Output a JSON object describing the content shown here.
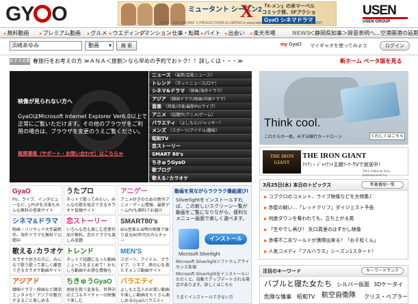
{
  "header": {
    "logo_prefix": "GY",
    "logo_suffix": "O",
    "banner": {
      "title": "ミュータント シーズン2",
      "x": "X",
      "promo": "『X-メン』の米マーベルコミック発、SFアクション!",
      "badge": "GyaO シネマドラマ",
      "copyright": "©2001 - 2002 MUTANT X PRODUCTIONS & LIMITED in association with FIREWORKS ENTERTAINMENT."
    },
    "usen_name": "USEN",
    "usen_group": "USEN GROUP"
  },
  "nav": {
    "items": [
      "無料動画",
      "プレミアム動画",
      "グルメ",
      "ウエディング",
      "マンション",
      "仕事・転職",
      "バイト",
      "出会い",
      "楽天市場"
    ],
    "news_label": "NEWS",
    "news_text": "＜静岡県知事＞辞意表明へ…空港開港の延期問"
  },
  "search": {
    "value": "浜崎あゆみ",
    "select": "動画",
    "button": "検 索",
    "mygyao_my": "my",
    "mygyao": "GyaO",
    "use_msg": "マイギャオを使ってみよう",
    "login": "ログイン"
  },
  "announce": {
    "tag": "おすすめ情報",
    "text": "春旅行をお考えの方 ≫ＡＮＡ＜旅割＞なら早めの予約でおトク！！詳しくは・・・≫",
    "newhome": "新ホーム ベータ版を見る"
  },
  "player": {
    "msg1": "映像が見られない方へ",
    "msg2": "GyaOはMicrosoft Internet Explorer Ver6.0以上で正常にご覧いただけます。その他のブラウザをご利用の場合は、ブラウザを変更のうえご覧ください。",
    "link": "推奨環境（サポート・お問い合わせ）はこちら≫"
  },
  "menu": [
    {
      "label": "ニュース",
      "sub": "（最新/芸能ニュース）"
    },
    {
      "label": "トレンド",
      "sub": "（ネットニュース/ロケ）"
    },
    {
      "label": "シネマ&ドラマ",
      "sub": "（映画/海外ドラマ）"
    },
    {
      "label": "アジア",
      "sub": "（韓国ドラマ/映画/中国ドラマ）"
    },
    {
      "label": "音楽",
      "sub": "（邦楽/洋楽/最新PV/ライブ）"
    },
    {
      "label": "アニメ",
      "sub": "（話題作/アニメ/ゲーム）"
    },
    {
      "label": "バラエティ",
      "sub": "（よしもと/ジャッキー）"
    },
    {
      "label": "メンズ",
      "sub": "（スポーツ/アイドル/趣味）"
    },
    {
      "label": "昭和TV",
      "sub": ""
    },
    {
      "label": "恋ストーリー",
      "sub": ""
    },
    {
      "label": "SMART 80's",
      "sub": ""
    },
    {
      "label": "ちきゅうGyaO",
      "sub": ""
    },
    {
      "label": "歌ブログ",
      "sub": ""
    },
    {
      "label": "歌える♪カラオケ",
      "sub": ""
    }
  ],
  "tiles": [
    {
      "title": "GyaO",
      "desc": "PV、ライブ、インタビューなど、J-POPを洋楽もみんな無料の音楽サイト",
      "color": "#c8102e"
    },
    {
      "title": "うたプロ",
      "desc": "ネットで歌ってみたい。みんなの歌を採点できるカラオケ投稿サイト",
      "color": "#222222"
    },
    {
      "title": "アニゲー",
      "desc": "アニメ好きのための新作アニメ・ゲーム情報、最新ゲームPVも無料でお届け",
      "color": "#e64a9a"
    },
    {
      "title": "シネマ&ドラマ",
      "desc": "映画・ハリウッド大作最新作。海外ドラマも無料で公開中",
      "color": "#1f5bc0"
    },
    {
      "title": "恋ストーリー",
      "desc": "いろんな恋も楽しむ恋愛作品が無料。恋のドラマも楽しみ放題",
      "color": "#d6337a"
    },
    {
      "title": "SMART80's",
      "desc": "80s音楽＆当時の映像で振り返る80年代のカルチャー",
      "color": "#333333"
    },
    {
      "title": "歌える♪カラオケ",
      "desc": "カラオケ好きの方に、みんなで歌う歌って楽しく練習できるカラオケ動画サイト",
      "color": "#222222"
    },
    {
      "title": "トレンド",
      "desc": "ネットで話題になった動画ニュースをまとめて！おもしろ動画やお得な情報も",
      "color": "#2b7a2b"
    },
    {
      "title": "MEN'S",
      "desc": "スポーツ、アイドル、グラビア、シネマ…男の心を満たすメンズ動画サイト",
      "color": "#2a7fb8"
    },
    {
      "title": "アジアド",
      "desc": "韓国ドラマ・映画など韓流エンタメも！アジアの魅力がまるごと楽しめる",
      "color": "#e05a1a"
    },
    {
      "title": "ちきゅうGyaO",
      "desc": "地球を救う変身を、世界中のエコ＆ネイチャーの映像で楽しむ",
      "color": "#2b8a2b"
    },
    {
      "title": "バラエティ",
      "desc": "よしもと芸人のお笑い動画や楽しい動画をたくさん楽しめるGyaOバラエティ",
      "color": "#e08a00"
    }
  ],
  "silverlight": {
    "heading": "動画を見ながらラクラク番組選び!",
    "desc": "Silverlightをインストールすれば、この新しいスクリーン一覧が動画をご覧になりながら、便利なメニュー画面で楽しく選べます。",
    "install": "インストール",
    "logo_text": "Microsoft Silverlight",
    "links": [
      "Microsoft Silverlightソフトウェアライセンス条項",
      "Microsoft Silverlightをインストールいただくと、自動でアップデートされる場合があります。詳しくはこちら",
      "うまくインストールできない方"
    ]
  },
  "ad1": {
    "headline": "Think cool.",
    "line": "これからの一枚。みずほ銀行カードローン",
    "button": "くわしくはこちら"
  },
  "ad2": {
    "thumb": "THE IRON GIANT",
    "title": "THE IRON GIANT",
    "text": "ｱｲｱﾝ・ｼﾞｬｲｱﾝﾄ主題ﾜｰﾅｰTVで放送中！",
    "copy": "TM & ©Warner Bros. Entertainment Inc."
  },
  "topics": {
    "date": "3月25日(水) 本日のトピックス",
    "new_button": "新着番組一覧",
    "items": [
      "コブクロのコメント、ライブ映像などを大特集♪",
      "赤壁の戦い…「レッドクリフ」ダイジェスト予告",
      "何度ダウンを奪われても、立ち上がる男",
      "「生やでし再び！ 矢口真里のはずかし映像",
      "赤塚不二夫ワールドが満喫出来る！「おそ松くん」",
      "人気コメディ「フルハウス」シーズン1スタート！"
    ]
  },
  "keywords": {
    "title": "注目のキーワード",
    "button": "キーワードランク",
    "items": [
      "バブルと寝た女たち",
      "シルバー仮面",
      "3Dケータイ",
      "危険な情事",
      "昭和TV",
      "航空自衛隊",
      "クリス・ペプラー"
    ]
  }
}
